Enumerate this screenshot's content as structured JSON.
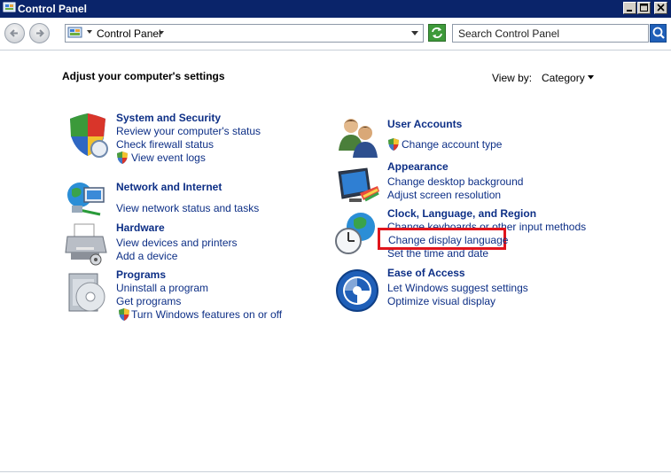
{
  "window": {
    "title": "Control Panel"
  },
  "address_bar": {
    "breadcrumb": "Control Panel",
    "search_placeholder": "Search Control Panel"
  },
  "main": {
    "heading": "Adjust your computer's settings",
    "view_by_label": "View by:",
    "view_by_value": "Category"
  },
  "categories": [
    {
      "title": "System and Security",
      "icon": "shield-icon",
      "links": [
        "Review your computer's status",
        "Check firewall status",
        "View event logs"
      ]
    },
    {
      "title": "Network and Internet",
      "icon": "network-globe-icon",
      "links": [
        "View network status and tasks"
      ]
    },
    {
      "title": "Hardware",
      "icon": "printer-icon",
      "links": [
        "View devices and printers",
        "Add a device"
      ]
    },
    {
      "title": "Programs",
      "icon": "program-disc-icon",
      "links": [
        "Uninstall a program",
        "Get programs",
        "Turn Windows features on or off"
      ]
    },
    {
      "title": "User Accounts",
      "icon": "users-icon",
      "links": [
        "Change account type"
      ]
    },
    {
      "title": "Appearance",
      "icon": "display-palette-icon",
      "links": [
        "Change desktop background",
        "Adjust screen resolution"
      ]
    },
    {
      "title": "Clock, Language, and Region",
      "icon": "clock-globe-icon",
      "links": [
        "Change keyboards or other input methods",
        "Change display language",
        "Set the time and date"
      ]
    },
    {
      "title": "Ease of Access",
      "icon": "ease-of-access-icon",
      "links": [
        "Let Windows suggest settings",
        "Optimize visual display"
      ]
    }
  ],
  "colors": {
    "title_bar": "#0a246a",
    "link": "#0d2f86",
    "highlight_box": "#e0141c"
  }
}
